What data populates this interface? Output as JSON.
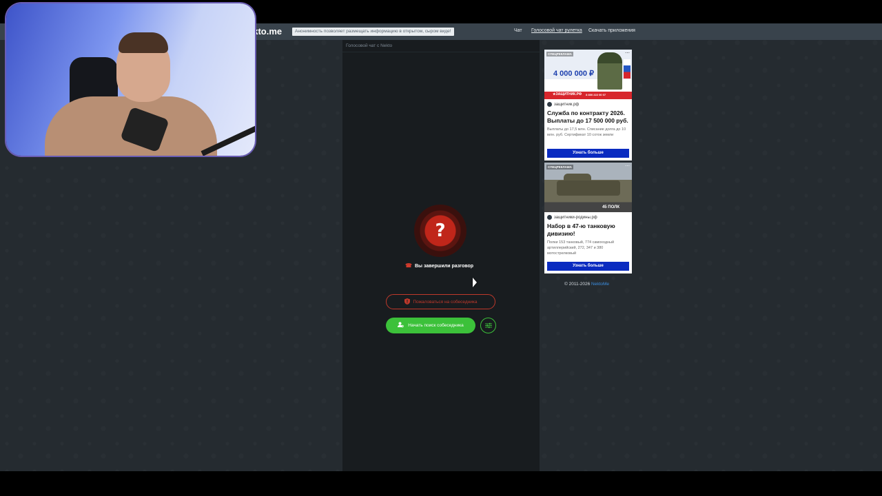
{
  "header": {
    "brand": "ekto.me",
    "tagline": "Анонимность позволяет размещать информацию в открытом, сыром виде!",
    "nav": [
      {
        "label": "Чат",
        "active": false
      },
      {
        "label": "Голосовой чат рулетка",
        "active": true
      },
      {
        "label": "Скачать приложения",
        "active": false
      }
    ]
  },
  "chat": {
    "header": "Голосовой чат с Nekto",
    "status_icon": "question-icon",
    "status_glyph": "?",
    "status_text": "Вы завершили разговор",
    "report_label": "Пожаловаться на собеседника",
    "search_label": "Начать поиск собеседника",
    "accent_green": "#3cc13a",
    "accent_red": "#c0392b"
  },
  "ads": [
    {
      "badge": "СПЕЦРЕКЛАМА",
      "amount": "4 000 000 ₽",
      "footer": "★ЗАЩИТНИК.РФ",
      "phone": "8 800 222 00 07",
      "domain": "защитник.рф",
      "title": "Служба по контракту 2026. Выплаты до 17 500 000 руб.",
      "text": "Выплаты до 17,5 млн. Списание долга до 10 млн. руб. Сертификат 10 соток земли",
      "button": "Узнать больше"
    },
    {
      "badge": "СПЕЦРЕКЛАМА",
      "tag": "45 ПОЛК",
      "domain": "защитники-родины.рф",
      "title": "Набор в 47-ю танковую дивизию!",
      "text": "Полки 153 танковый, 774 самоходный артиллерийский, 272, 347 и 380 мотострелковый",
      "button": "Узнать больше"
    }
  ],
  "footer": {
    "copyright": "© 2011-2026",
    "link": "NektoMe"
  }
}
